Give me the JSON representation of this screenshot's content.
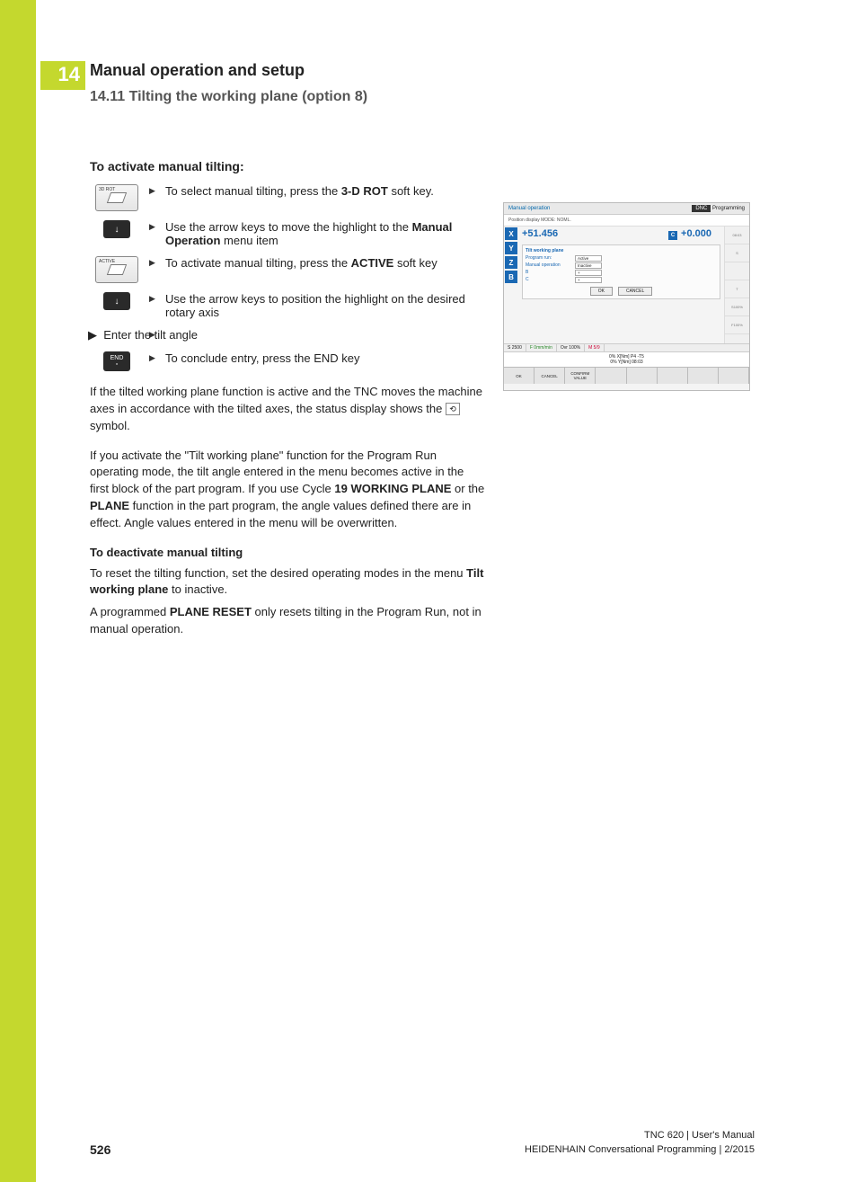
{
  "chapter_num": "14",
  "h1": "Manual operation and setup",
  "h2": "14.11 Tilting the working plane (option 8)",
  "activate": {
    "heading": "To activate manual tilting:",
    "steps": [
      {
        "icon_label": "3D ROT",
        "text_pre": "To select manual tilting, press the ",
        "bold": "3-D ROT",
        "text_post": " soft key."
      },
      {
        "text_pre": "Use the arrow keys to move the highlight to the ",
        "bold": "Manual Operation",
        "text_post": " menu item"
      },
      {
        "icon_label": "ACTIVE",
        "text_pre": "To activate manual tilting, press the ",
        "bold": "ACTIVE",
        "text_post": " soft key"
      },
      {
        "text_pre": "Use the arrow keys to position the highlight on the desired rotary axis",
        "bold": "",
        "text_post": ""
      }
    ],
    "enter_angle": "Enter the tilt angle",
    "end_step": "To conclude entry, press the END key",
    "end_label": "END"
  },
  "para1_a": "If the tilted working plane function is active and the TNC moves the machine axes in accordance with the tilted axes, the status display shows the ",
  "para1_b": " symbol.",
  "para2_a": "If you activate the \"Tilt working plane\" function for the Program Run operating mode, the tilt angle entered in the menu becomes active in the first block of the part program. If you use Cycle ",
  "para2_b1": "19 WORKING PLANE",
  "para2_c": " or the ",
  "para2_b2": "PLANE",
  "para2_d": " function in the part program, the angle values defined there are in effect. Angle values entered in the menu will be overwritten.",
  "deact_heading": "To deactivate manual tilting",
  "deact_p1_a": "To reset the tilting function, set the desired operating modes in the menu ",
  "deact_p1_b": "Tilt working plane",
  "deact_p1_c": " to inactive.",
  "deact_p2_a": "A programmed ",
  "deact_p2_b": "PLANE RESET",
  "deact_p2_c": " only resets tilting in the Program Run, not in manual operation.",
  "screenshot": {
    "mode_left": "Manual operation",
    "mode_right_dnc": "DNC",
    "mode_right": "Programming",
    "sub": "Position display MODE: NOML.",
    "axes": [
      "X",
      "Y",
      "Z",
      "B"
    ],
    "big_val_left": "+51.456",
    "big_axis_c": "C",
    "big_val_right": "+0.000",
    "dlg_title": "Tilt working plane",
    "dlg_rows": [
      {
        "lbl": "Program run:",
        "val": "Active"
      },
      {
        "lbl": "Manual operation",
        "val": "Inactive"
      },
      {
        "lbl": "B",
        "val": "+"
      },
      {
        "lbl": "C",
        "val": "+"
      }
    ],
    "dlg_ok": "OK",
    "dlg_cancel": "CANCEL",
    "status_s": "S 2500",
    "status_f": "F 0mm/min",
    "status_ovr": "Ovr 100%",
    "status_m": "M 5/9",
    "feed1": "0% X[Nm] P4 -T5",
    "feed2": "0% Y[Nm] 08:03",
    "side_labels": [
      "08:03",
      "S",
      "",
      "T",
      "S100%",
      "F100%"
    ],
    "softkeys": [
      "OK",
      "CANCEL",
      "CONFIRM VALUE",
      "",
      "",
      "",
      "",
      ""
    ]
  },
  "footer": {
    "page": "526",
    "line1": "TNC 620 | User's Manual",
    "line2": "HEIDENHAIN Conversational Programming | 2/2015"
  }
}
